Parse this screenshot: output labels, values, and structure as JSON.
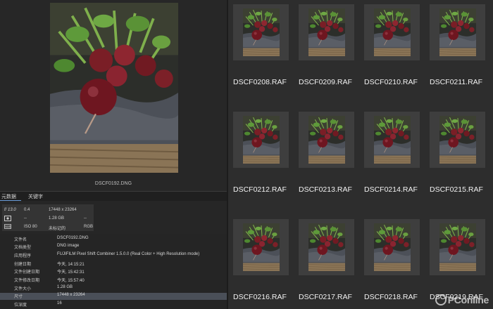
{
  "preview": {
    "filename": "DSCF0192.DNG"
  },
  "tabs": [
    {
      "label": "元数据"
    },
    {
      "label": "关键字"
    }
  ],
  "camera_info": {
    "aperture": "f/ 13.0",
    "shutter": "0.4",
    "dash1": "--",
    "dash2": "--",
    "iso": "ISO 80",
    "dimensions": "17448 x 23264",
    "file_size": "1.28 GB",
    "rating": "未标记的",
    "color_mode": "RGB"
  },
  "metadata": [
    {
      "key": "文件名",
      "value": "DSCF0192.DNG"
    },
    {
      "key": "文档类型",
      "value": "DNG image"
    },
    {
      "key": "应用程序",
      "value": "FUJIFILM Pixel Shift Combiner 1.5.0.0 (Real Color + High Resolution mode)"
    },
    {
      "key": "创建日期",
      "value": "今天, 14:15:21"
    },
    {
      "key": "文件创建日期",
      "value": "今天, 15:42:31"
    },
    {
      "key": "文件修改日期",
      "value": "今天, 15:57:40"
    },
    {
      "key": "文件大小",
      "value": "1.28 GB"
    },
    {
      "key": "尺寸",
      "value": "17448 x 23264"
    },
    {
      "key": "位深度",
      "value": "16"
    }
  ],
  "grid": [
    {
      "name": "DSCF0208.RAF"
    },
    {
      "name": "DSCF0209.RAF"
    },
    {
      "name": "DSCF0210.RAF"
    },
    {
      "name": "DSCF0211.RAF"
    },
    {
      "name": "DSCF0212.RAF"
    },
    {
      "name": "DSCF0213.RAF"
    },
    {
      "name": "DSCF0214.RAF"
    },
    {
      "name": "DSCF0215.RAF"
    },
    {
      "name": "DSCF0216.RAF"
    },
    {
      "name": "DSCF0217.RAF"
    },
    {
      "name": "DSCF0218.RAF"
    },
    {
      "name": "DSCF0219.RAF"
    }
  ],
  "watermark": {
    "text": "PConline"
  },
  "colors": {
    "selected_row": "#4a4f58",
    "tab_accent": "#6a9bd8"
  }
}
